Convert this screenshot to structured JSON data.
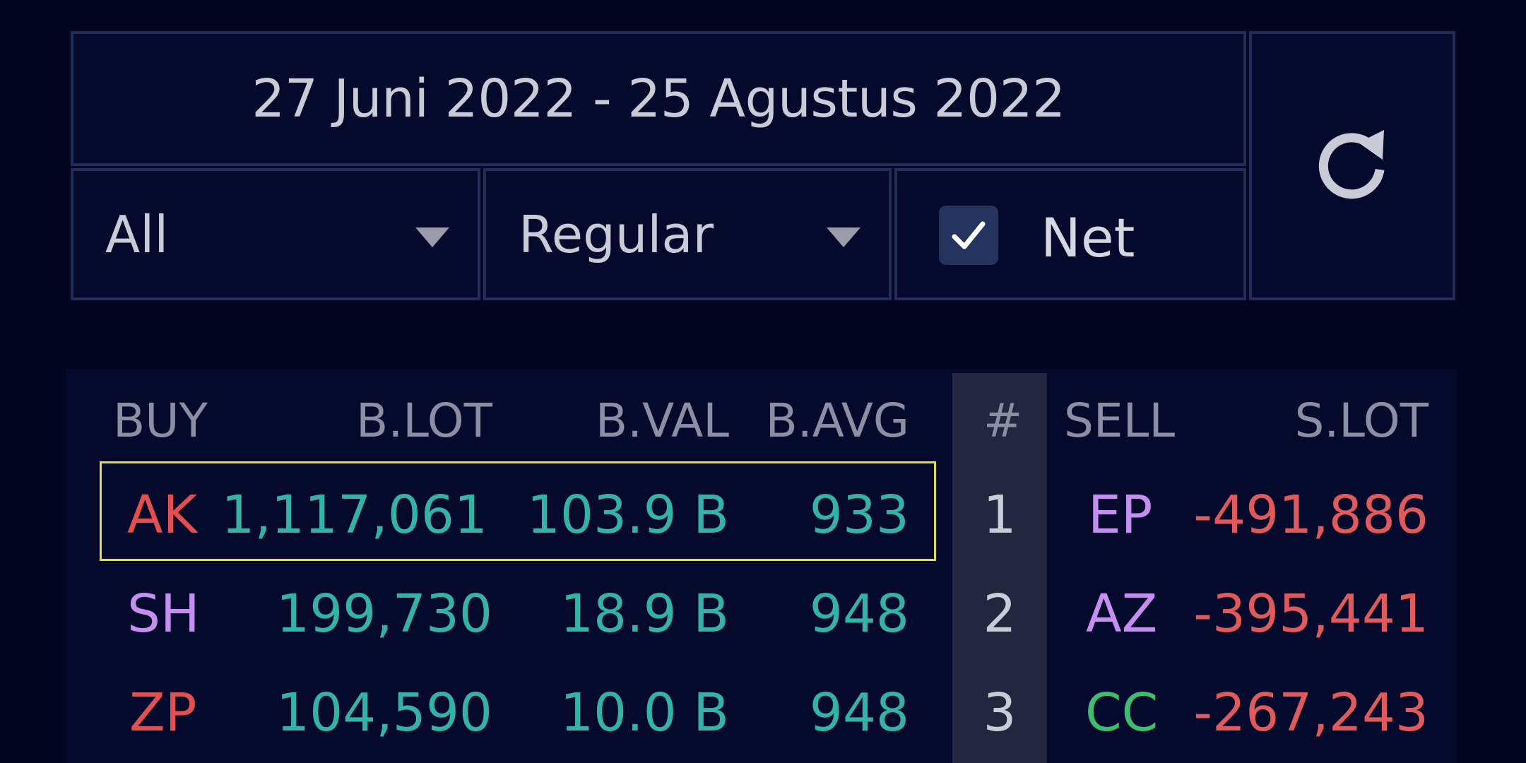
{
  "filters": {
    "date_range": "27 Juni 2022 - 25 Agustus 2022",
    "investor_type": "All",
    "market": "Regular",
    "net_label": "Net",
    "net_checked": true
  },
  "icons": {
    "refresh": "refresh-icon",
    "dropdown": "chevron-down-icon",
    "check": "check-icon"
  },
  "table": {
    "headers": {
      "buy": "BUY",
      "blot": "B.LOT",
      "bval": "B.VAL",
      "bavg": "B.AVG",
      "hash": "#",
      "sell": "SELL",
      "slot": "S.LOT"
    },
    "rows": [
      {
        "buy": "AK",
        "blot": "1,117,061",
        "bval": "103.9 B",
        "bavg": "933",
        "num": "1",
        "sell": "EP",
        "slot": "-491,886"
      },
      {
        "buy": "SH",
        "blot": "199,730",
        "bval": "18.9 B",
        "bavg": "948",
        "num": "2",
        "sell": "AZ",
        "slot": "-395,441"
      },
      {
        "buy": "ZP",
        "blot": "104,590",
        "bval": "10.0 B",
        "bavg": "948",
        "num": "3",
        "sell": "CC",
        "slot": "-267,243"
      }
    ],
    "colors": {
      "value": "#33b3a6",
      "sell_lot": "#e05a5c",
      "broker_red": "#e24f4f",
      "broker_violet": "#c58ef0",
      "broker_green": "#3dbd70",
      "highlight": "#e6e03a"
    },
    "highlighted_row": 1
  }
}
